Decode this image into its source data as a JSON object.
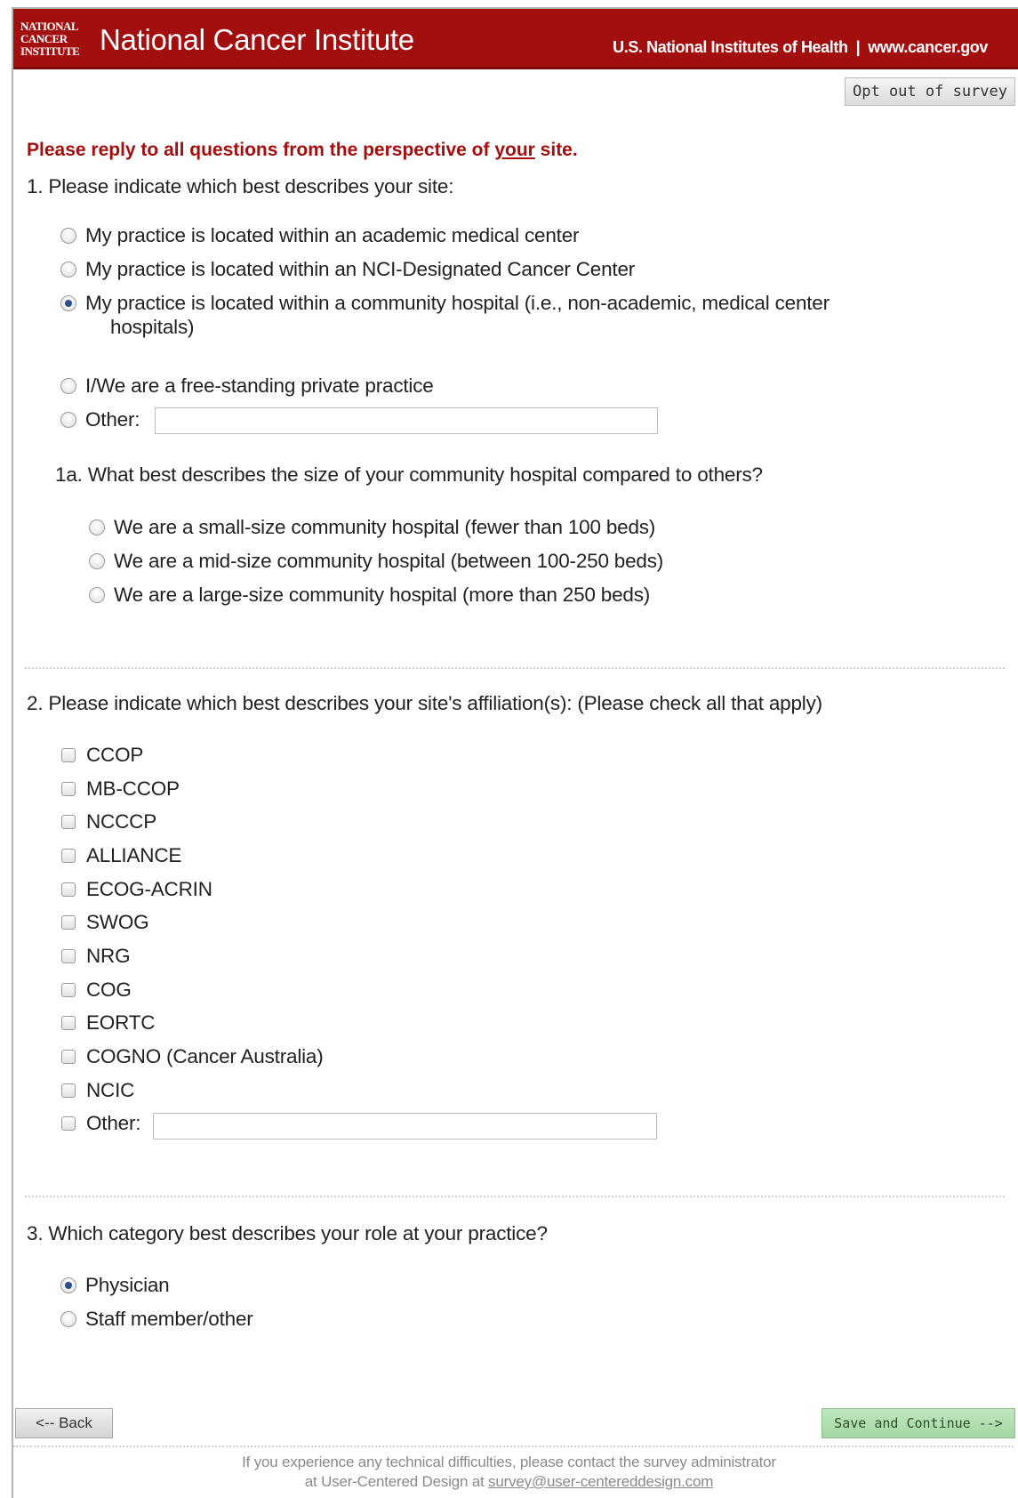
{
  "header": {
    "logo_lines": [
      "NATIONAL",
      "CANCER",
      "INSTITUTE"
    ],
    "title": "National Cancer Institute",
    "nih_link": "U.S. National Institutes of Health",
    "separator": "|",
    "site_link": "www.cancer.gov"
  },
  "opt_out_label": "Opt out of survey",
  "intro": {
    "before": "Please reply to all questions from the perspective of ",
    "emphasis": "your",
    "after": " site."
  },
  "q1": {
    "text": "1. Please indicate which best describes your site:",
    "options": [
      "My practice is located within an academic medical center",
      "My practice is located within an NCI-Designated Cancer Center",
      "My practice is located within a community hospital (i.e., non-academic, medical center",
      "I/We are a free-standing private practice",
      "Other:"
    ],
    "option3_cont": "hospitals)",
    "selected_index": 2,
    "other_value": ""
  },
  "q1a": {
    "text": "1a. What best describes the size of your community hospital compared to others?",
    "options": [
      "We are a small-size community hospital (fewer than 100 beds)",
      "We are a mid-size community hospital (between 100-250 beds)",
      "We are a large-size community hospital (more than 250 beds)"
    ]
  },
  "q2": {
    "text": "2. Please indicate which best describes your site's affiliation(s): (Please check all that apply)",
    "options": [
      "CCOP",
      "MB-CCOP",
      "NCCCP",
      "ALLIANCE",
      "ECOG-ACRIN",
      "SWOG",
      "NRG",
      "COG",
      "EORTC",
      "COGNO (Cancer Australia)",
      "NCIC",
      "Other:"
    ],
    "other_value": ""
  },
  "q3": {
    "text": "3. Which category best describes your role at your practice?",
    "options": [
      "Physician",
      "Staff member/other"
    ],
    "selected_index": 0
  },
  "nav": {
    "back": "<-- Back",
    "save": "Save and Continue -->"
  },
  "footer": {
    "line1": "If you experience any technical difficulties, please contact the survey administrator",
    "line2_prefix": "at User-Centered Design at ",
    "email": "survey@user-centereddesign.com"
  }
}
